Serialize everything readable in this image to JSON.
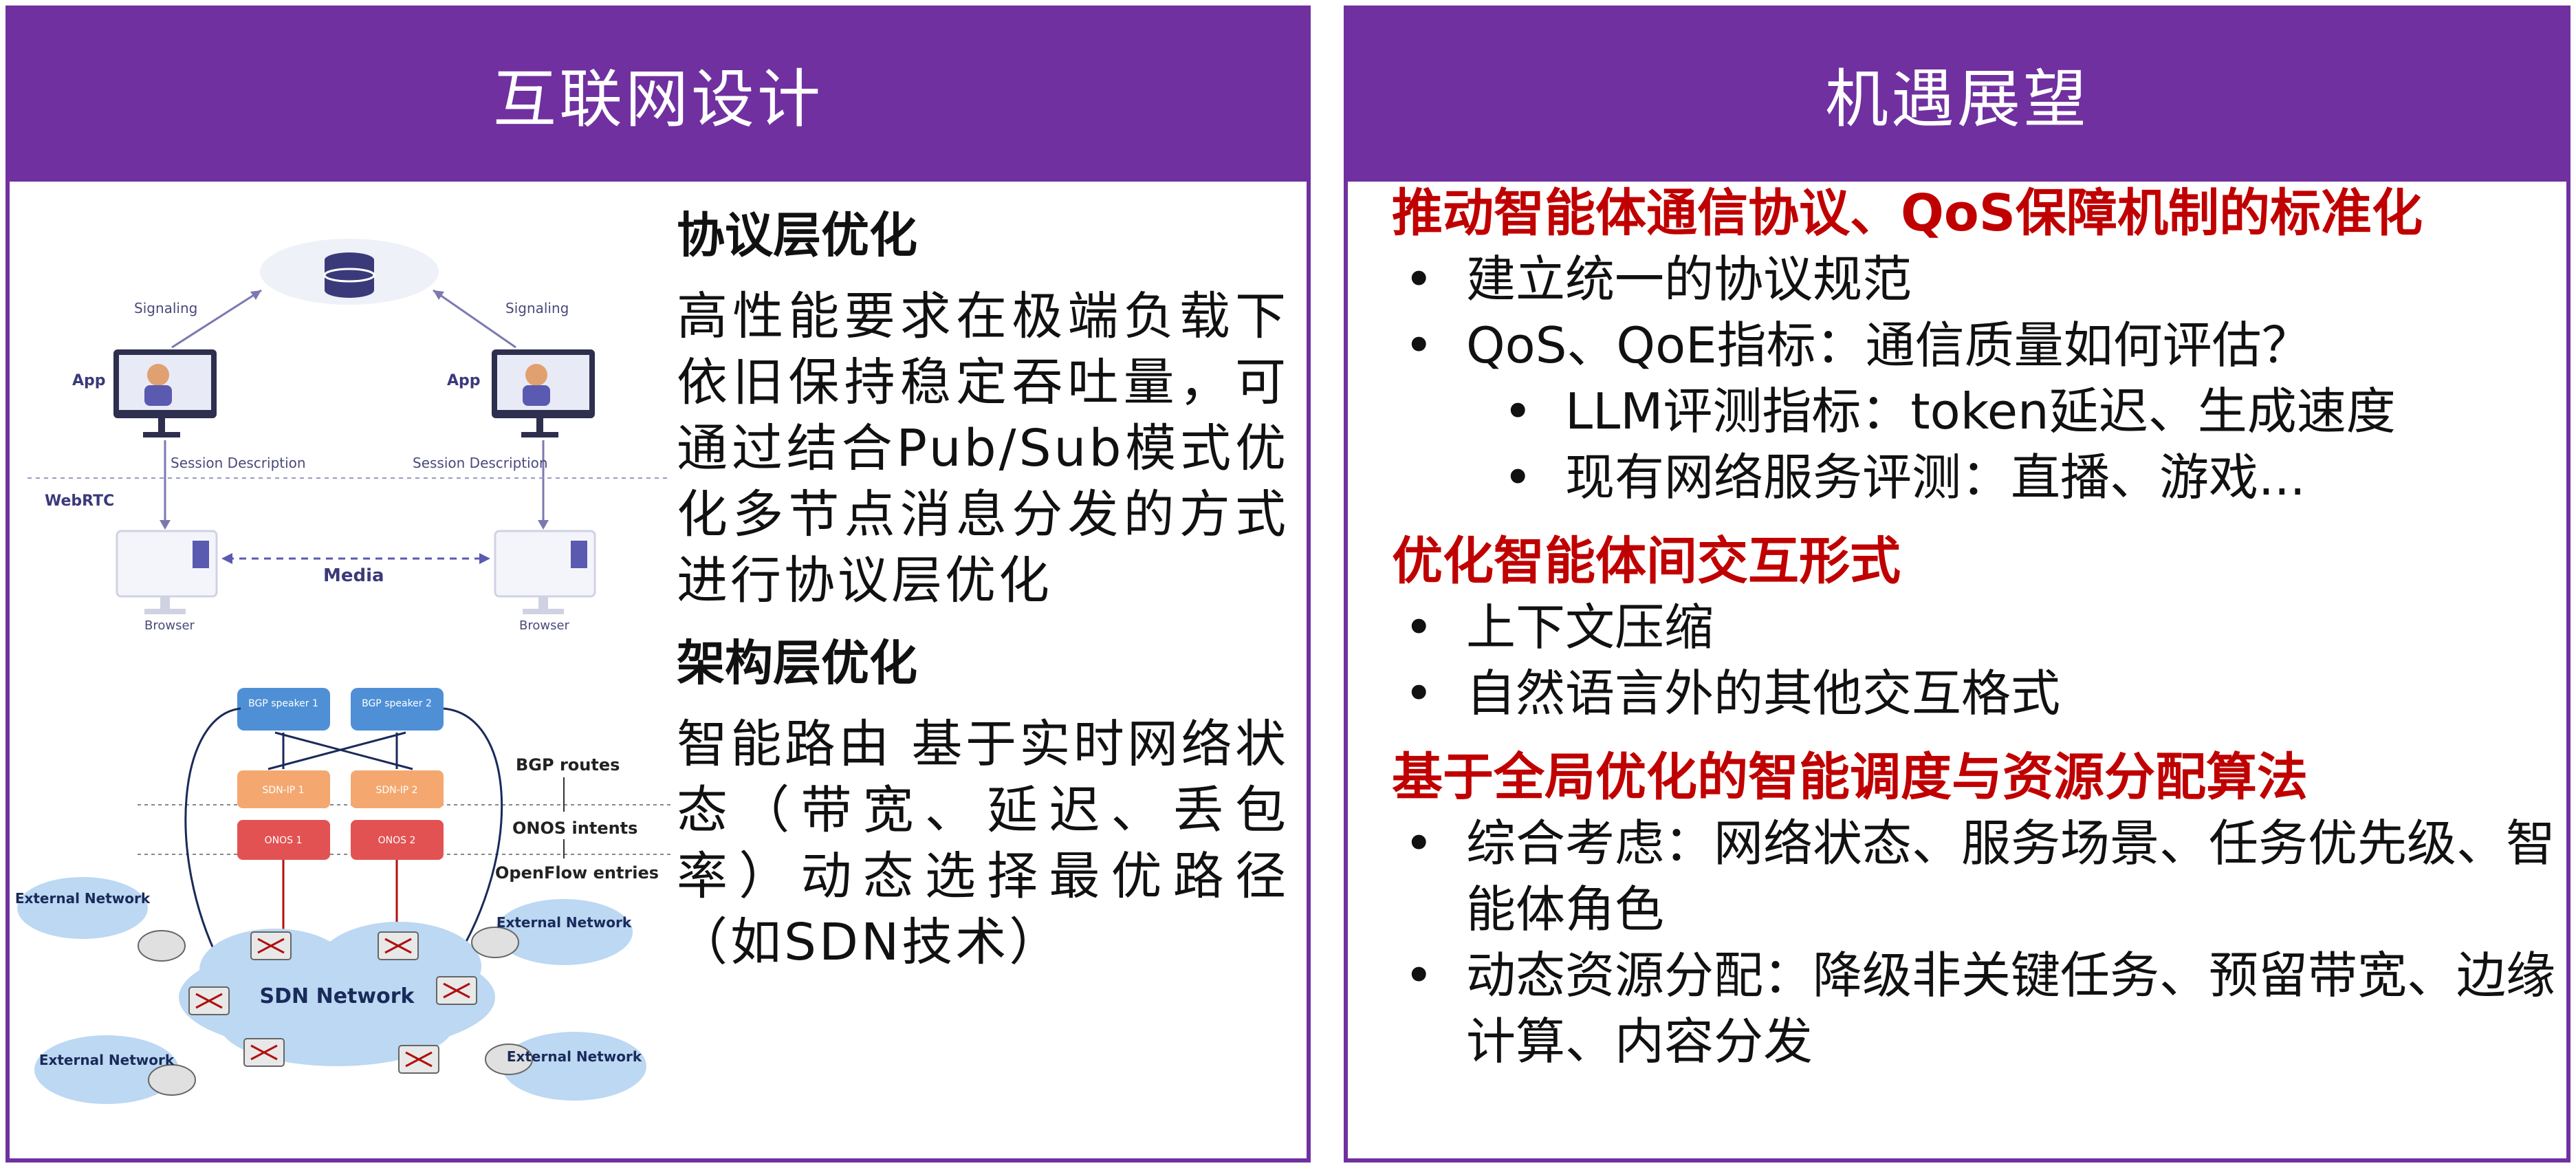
{
  "left_panel": {
    "title": "互联网设计",
    "sections": [
      {
        "heading": "协议层优化",
        "body": "高性能要求在极端负载下依旧保持稳定吞吐量，可通过结合Pub/Sub模式优化多节点消息分发的方式进行协议层优化"
      },
      {
        "heading": "架构层优化",
        "body": "智能路由 基于实时网络状态（带宽、延迟、丢包率）动态选择最优路径（如SDN技术）"
      }
    ],
    "webrtc_diagram": {
      "signaling_left": "Signaling",
      "signaling_right": "Signaling",
      "app_left": "App",
      "app_right": "App",
      "session_left": "Session Description",
      "session_right": "Session Description",
      "webrtc": "WebRTC",
      "media": "Media",
      "browser_left": "Browser",
      "browser_right": "Browser"
    },
    "sdn_diagram": {
      "bgp_speaker_1": "BGP speaker 1",
      "bgp_speaker_2": "BGP speaker 2",
      "sdn_ip_1": "SDN-IP 1",
      "sdn_ip_2": "SDN-IP 2",
      "onos_1": "ONOS 1",
      "onos_2": "ONOS 2",
      "bgp_routes": "BGP routes",
      "onos_intents": "ONOS intents",
      "openflow_entries": "OpenFlow entries",
      "sdn_network": "SDN Network",
      "external_network_1": "External Network",
      "external_network_2": "External Network",
      "external_network_3": "External Network",
      "external_network_4": "External Network"
    }
  },
  "right_panel": {
    "title": "机遇展望",
    "sections": [
      {
        "heading": "推动智能体通信协议、QoS保障机制的标准化",
        "items": [
          {
            "text": "建立统一的协议规范"
          },
          {
            "text": "QoS、QoE指标：通信质量如何评估？"
          },
          {
            "text": "LLM评测指标：token延迟、生成速度"
          },
          {
            "text": "现有网络服务评测：直播、游戏..."
          }
        ]
      },
      {
        "heading": "优化智能体间交互形式",
        "items": [
          {
            "text": "上下文压缩"
          },
          {
            "text": "自然语言外的其他交互格式"
          }
        ]
      },
      {
        "heading": "基于全局优化的智能调度与资源分配算法",
        "items": [
          {
            "text": "综合考虑：网络状态、服务场景、任务优先级、智能体角色"
          },
          {
            "text": "动态资源分配：降级非关键任务、预留带宽、边缘计算、内容分发"
          }
        ]
      }
    ]
  },
  "colors": {
    "header_purple": "#7030a0",
    "heading_red": "#c00000"
  }
}
